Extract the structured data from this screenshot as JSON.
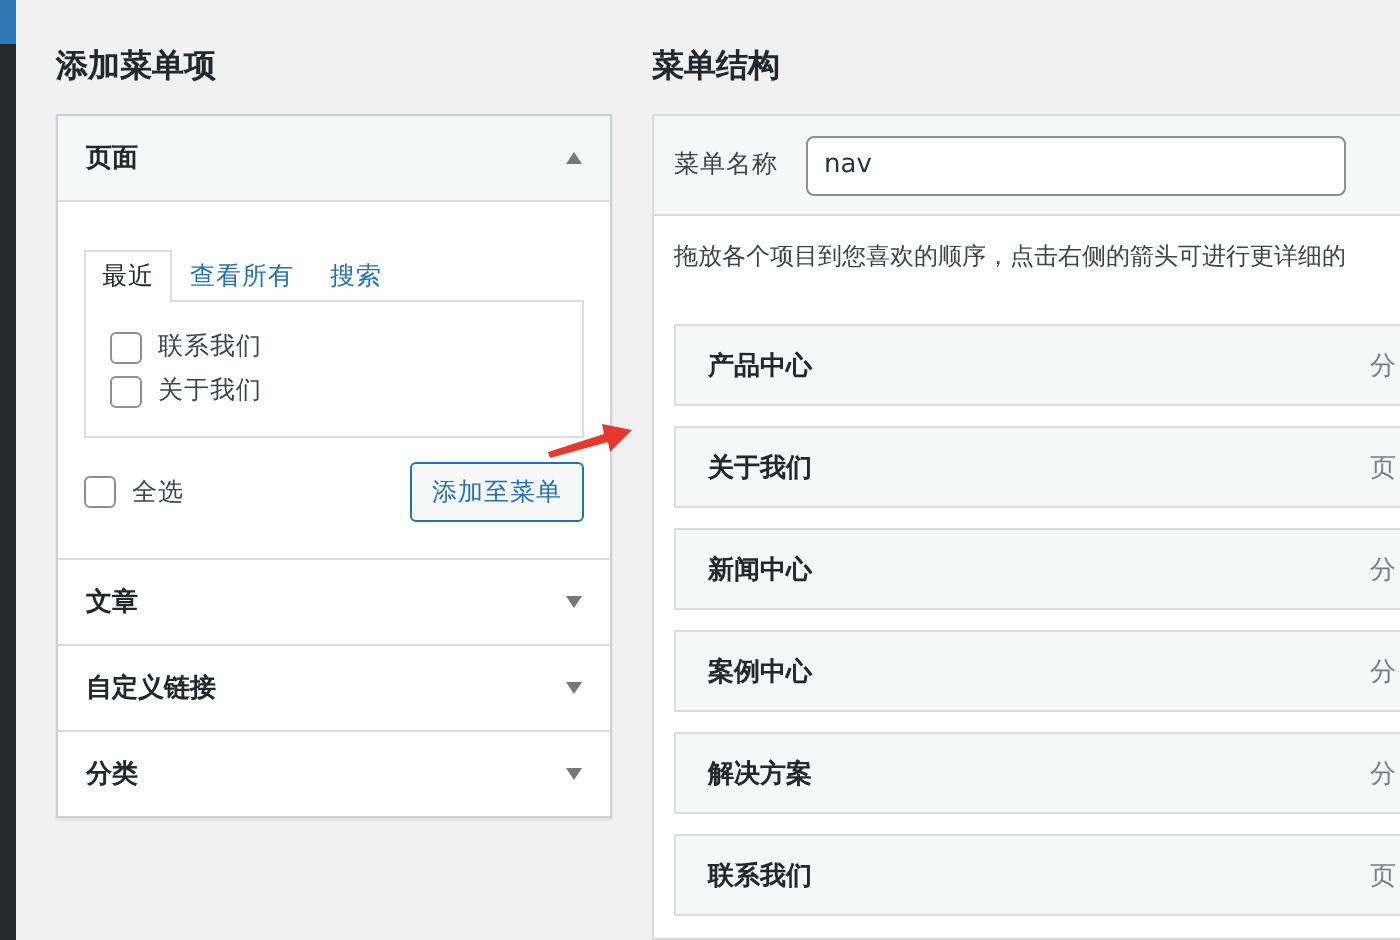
{
  "add_items": {
    "title": "添加菜单项",
    "sections": [
      {
        "label": "页面",
        "expanded": true,
        "tabs": [
          {
            "label": "最近",
            "selected": true
          },
          {
            "label": "查看所有",
            "selected": false
          },
          {
            "label": "搜索",
            "selected": false
          }
        ],
        "items": [
          {
            "label": "联系我们",
            "checked": false
          },
          {
            "label": "关于我们",
            "checked": false
          }
        ],
        "select_all": {
          "label": "全选",
          "checked": false
        },
        "add_button": "添加至菜单"
      },
      {
        "label": "文章",
        "expanded": false
      },
      {
        "label": "自定义链接",
        "expanded": false
      },
      {
        "label": "分类",
        "expanded": false
      }
    ]
  },
  "menu_structure": {
    "title": "菜单结构",
    "name_label": "菜单名称",
    "name_value": "nav",
    "instructions": "拖放各个项目到您喜欢的顺序，点击右侧的箭头可进行更详细的",
    "items": [
      {
        "title": "产品中心",
        "type": "分"
      },
      {
        "title": "关于我们",
        "type": "页"
      },
      {
        "title": "新闻中心",
        "type": "分"
      },
      {
        "title": "案例中心",
        "type": "分"
      },
      {
        "title": "解决方案",
        "type": "分"
      },
      {
        "title": "联系我们",
        "type": "页"
      }
    ]
  }
}
